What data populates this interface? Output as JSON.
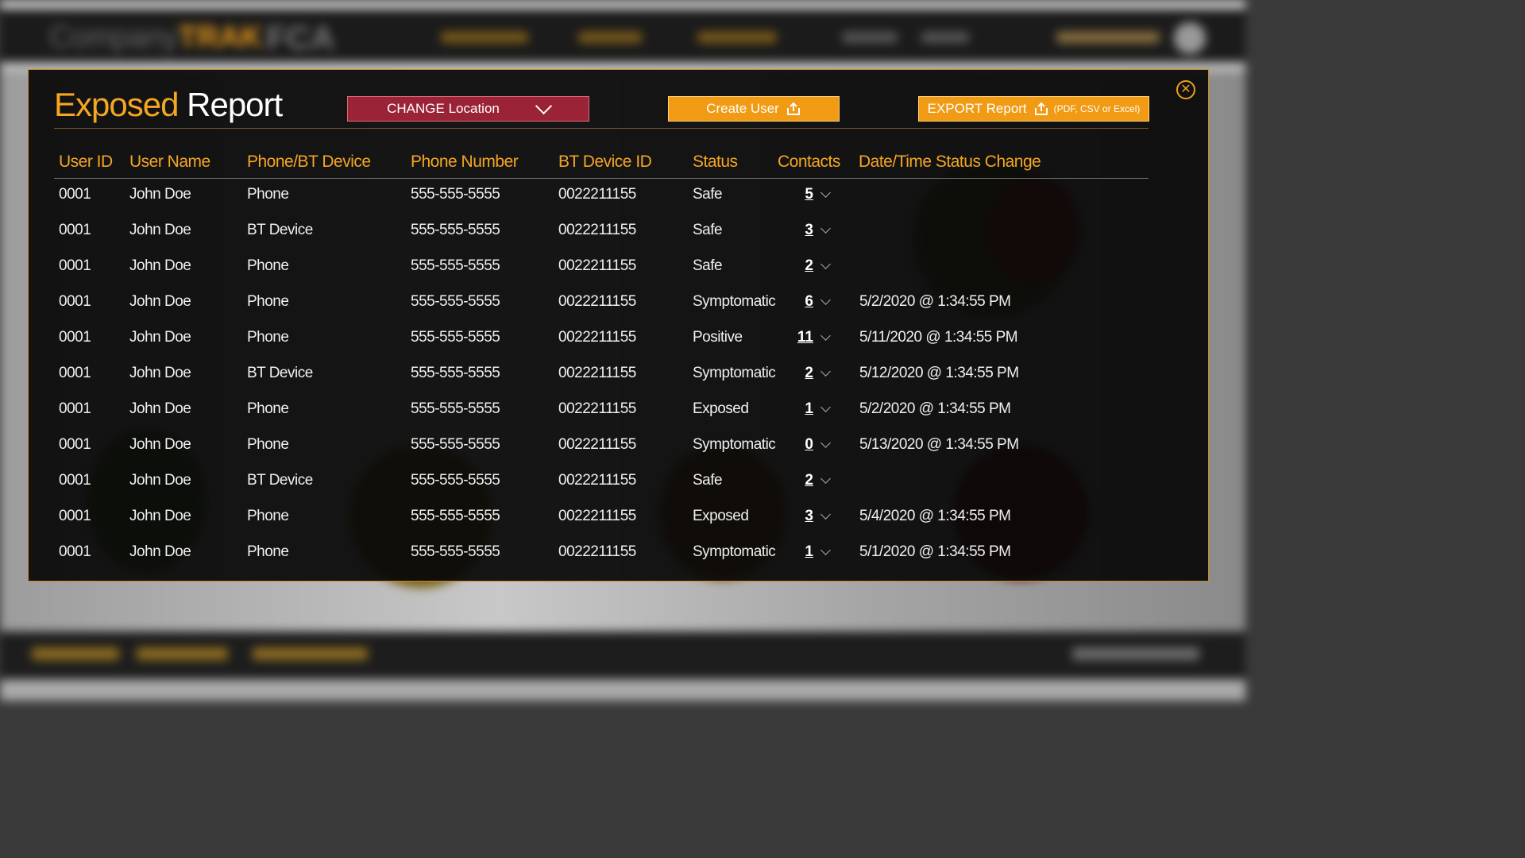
{
  "modal": {
    "title_part1": "Exposed",
    "title_part2": "Report",
    "close_label": "✕",
    "change_location_label": "CHANGE Location",
    "create_user_label": "Create User",
    "export_label": "EXPORT Report",
    "export_sub_label": "(PDF, CSV or Excel)"
  },
  "table": {
    "headers": [
      "User ID",
      "User Name",
      "Phone/BT Device",
      "Phone Number",
      "BT Device ID",
      "Status",
      "Contacts",
      "Date/Time Status Change"
    ],
    "rows": [
      {
        "user_id": "0001",
        "user_name": "John Doe",
        "device": "Phone",
        "phone": "555-555-5555",
        "bt_id": "0022211155",
        "status": "Safe",
        "contacts": "5",
        "datetime": ""
      },
      {
        "user_id": "0001",
        "user_name": "John Doe",
        "device": "BT Device",
        "phone": "555-555-5555",
        "bt_id": "0022211155",
        "status": "Safe",
        "contacts": "3",
        "datetime": ""
      },
      {
        "user_id": "0001",
        "user_name": "John Doe",
        "device": "Phone",
        "phone": "555-555-5555",
        "bt_id": "0022211155",
        "status": "Safe",
        "contacts": "2",
        "datetime": ""
      },
      {
        "user_id": "0001",
        "user_name": "John Doe",
        "device": "Phone",
        "phone": "555-555-5555",
        "bt_id": "0022211155",
        "status": "Symptomatic",
        "contacts": "6",
        "datetime": "5/2/2020  @ 1:34:55 PM"
      },
      {
        "user_id": "0001",
        "user_name": "John Doe",
        "device": "Phone",
        "phone": "555-555-5555",
        "bt_id": "0022211155",
        "status": "Positive",
        "contacts": "11",
        "datetime": "5/11/2020  @ 1:34:55 PM"
      },
      {
        "user_id": "0001",
        "user_name": "John Doe",
        "device": "BT Device",
        "phone": "555-555-5555",
        "bt_id": "0022211155",
        "status": "Symptomatic",
        "contacts": "2",
        "datetime": "5/12/2020  @ 1:34:55 PM"
      },
      {
        "user_id": "0001",
        "user_name": "John Doe",
        "device": "Phone",
        "phone": "555-555-5555",
        "bt_id": "0022211155",
        "status": "Exposed",
        "contacts": "1",
        "datetime": "5/2/2020  @ 1:34:55 PM"
      },
      {
        "user_id": "0001",
        "user_name": "John Doe",
        "device": "Phone",
        "phone": "555-555-5555",
        "bt_id": "0022211155",
        "status": "Symptomatic",
        "contacts": "0",
        "datetime": "5/13/2020  @ 1:34:55 PM"
      },
      {
        "user_id": "0001",
        "user_name": "John Doe",
        "device": "BT Device",
        "phone": "555-555-5555",
        "bt_id": "0022211155",
        "status": "Safe",
        "contacts": "2",
        "datetime": ""
      },
      {
        "user_id": "0001",
        "user_name": "John Doe",
        "device": "Phone",
        "phone": "555-555-5555",
        "bt_id": "0022211155",
        "status": "Exposed",
        "contacts": "3",
        "datetime": "5/4/2020  @ 1:34:55 PM"
      },
      {
        "user_id": "0001",
        "user_name": "John Doe",
        "device": "Phone",
        "phone": "555-555-5555",
        "bt_id": "0022211155",
        "status": "Symptomatic",
        "contacts": "1",
        "datetime": "5/1/2020  @ 1:34:55 PM"
      }
    ]
  },
  "icons": {
    "close": "close-circle-icon",
    "dropdown": "chevron-down-icon",
    "share": "share-upload-icon",
    "row_expand": "chevron-down-icon"
  },
  "colors": {
    "accent": "#f5a623",
    "button_orange": "#f19a13",
    "button_red": "#9b2338",
    "modal_bg": "#080808"
  }
}
